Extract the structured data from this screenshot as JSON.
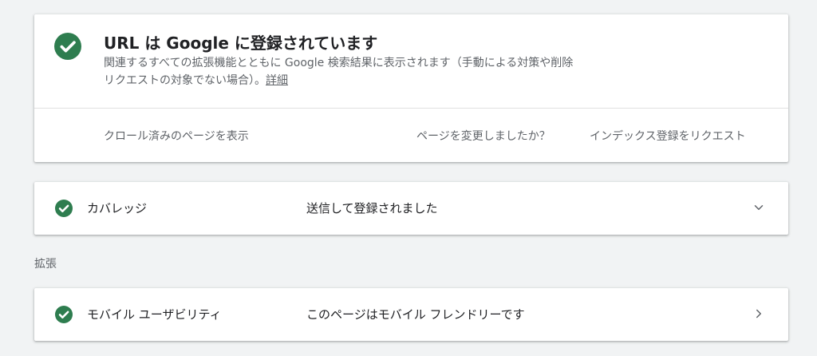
{
  "status": {
    "title": "URL は Google に登録されています",
    "description": "関連するすべての拡張機能とともに Google 検索結果に表示されます（手動による対策や削除リクエストの対象でない場合）。",
    "details_link": "詳細",
    "icon": "check-circle-icon",
    "actions": {
      "view_crawled": "クロール済みのページを表示",
      "changed_question": "ページを変更しましたか？",
      "request_indexing": "インデックス登録をリクエスト"
    }
  },
  "coverage": {
    "label": "カバレッジ",
    "value": "送信して登録されました",
    "icon": "check-circle-icon",
    "chevron": "chevron-down-icon"
  },
  "enhancements": {
    "heading": "拡張",
    "mobile": {
      "label": "モバイル ユーザビリティ",
      "value": "このページはモバイル フレンドリーです",
      "icon": "check-circle-icon",
      "chevron": "chevron-right-icon"
    }
  },
  "colors": {
    "success": "#34a853",
    "page_bg": "#f1f3f4",
    "card_bg": "#ffffff",
    "secondary_text": "#5f6368"
  }
}
